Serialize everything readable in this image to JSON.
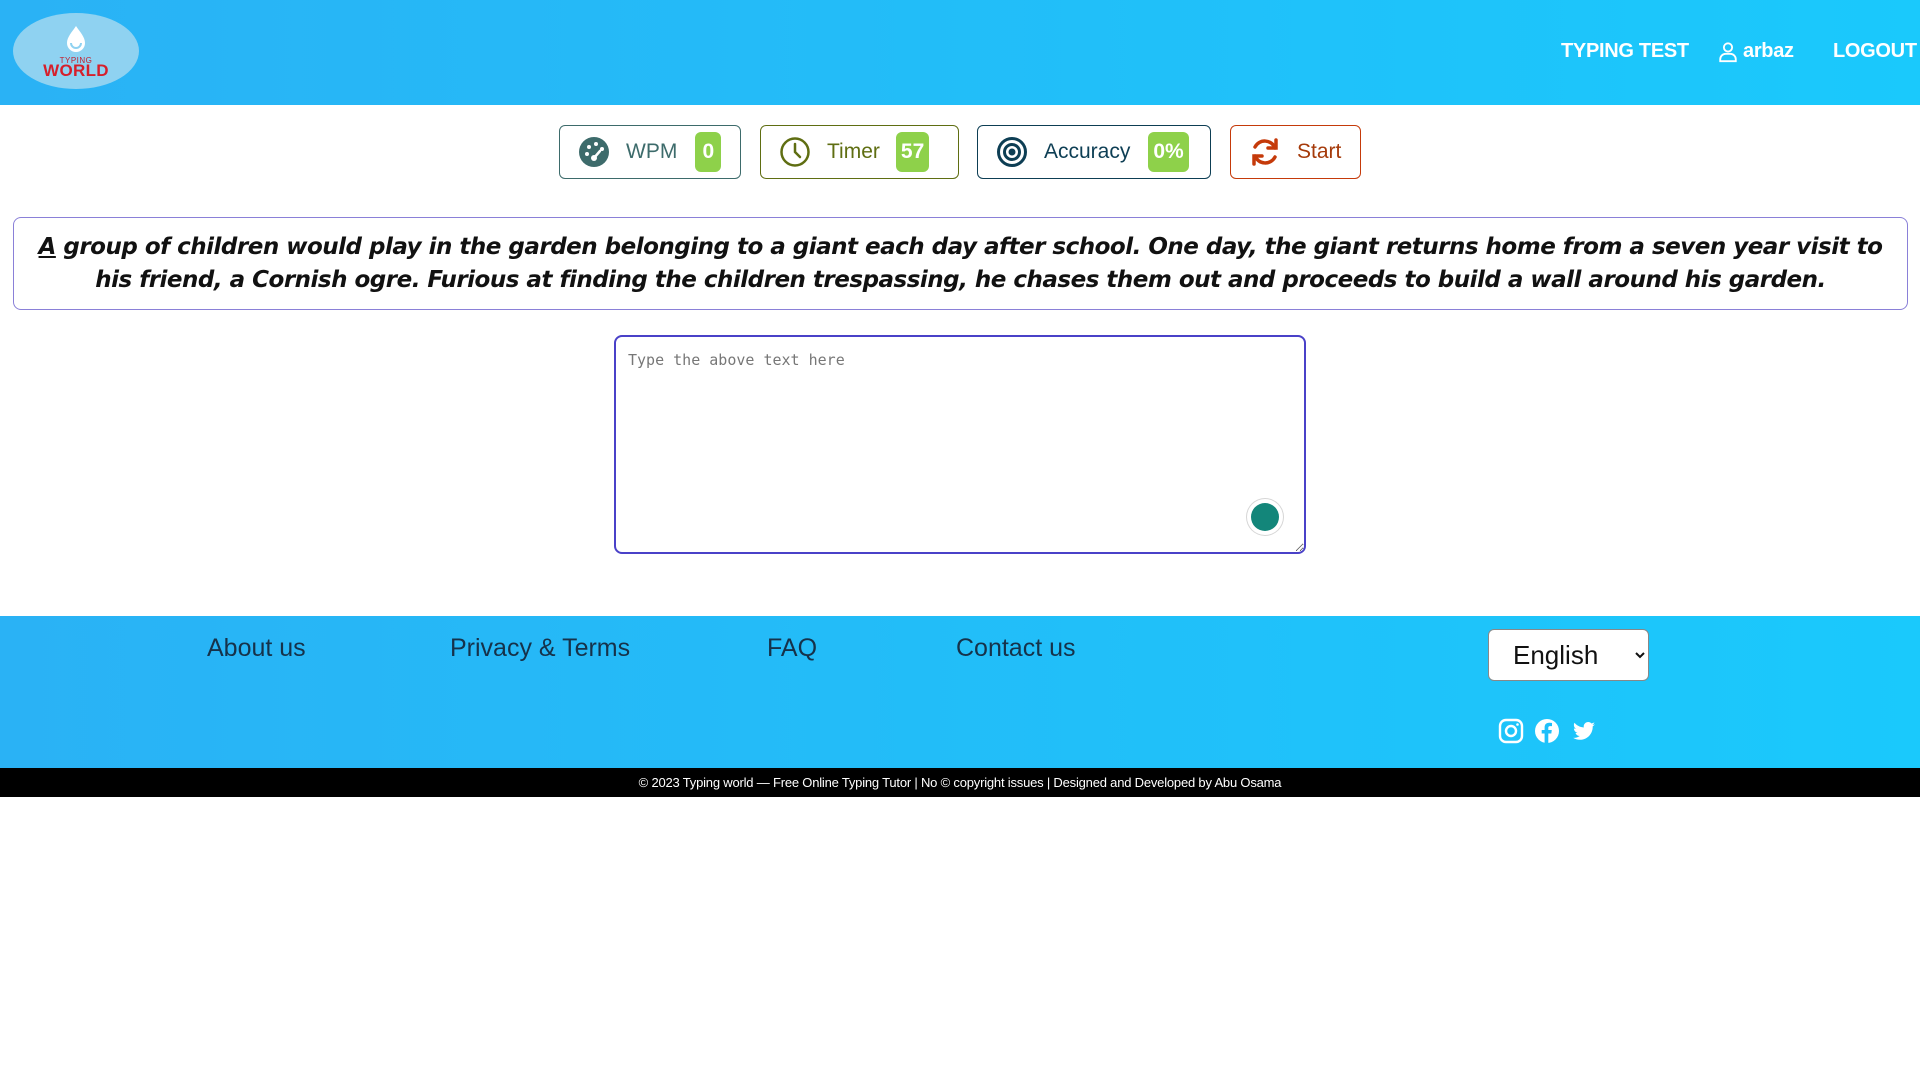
{
  "brand": {
    "logo_small_text": "TYPING",
    "logo_main_text": "WORLD",
    "logo_main_color": "#d61f2b"
  },
  "nav": {
    "typing_test_label": "TYPING TEST",
    "username": "arbaz",
    "logout_label": "LOGOUT"
  },
  "stats": {
    "wpm": {
      "label": "WPM",
      "value": "0",
      "icon": "gauge-icon"
    },
    "timer": {
      "label": "Timer",
      "value": "57",
      "icon": "clock-icon"
    },
    "accuracy": {
      "label": "Accuracy",
      "value": "0%",
      "icon": "target-icon"
    },
    "start": {
      "label": "Start",
      "icon": "refresh-icon"
    },
    "value_badge_color": "#8ed14a"
  },
  "passage": {
    "first_word": "A",
    "rest": " group of children would play in the garden belonging to a giant each day after school. One day, the giant returns home from a seven year visit to his friend, a Cornish ogre. Furious at finding the children trespassing, he chases them out and proceeds to build a wall around his garden."
  },
  "input": {
    "placeholder": "Type the above text here",
    "value": ""
  },
  "footer": {
    "links": [
      "About us",
      "Privacy & Terms",
      "FAQ",
      "Contact us"
    ],
    "language": {
      "selected": "English",
      "options": [
        "English"
      ]
    },
    "social_icons": [
      "instagram-icon",
      "facebook-icon",
      "twitter-icon"
    ],
    "copyright": "© 2023 Typing world — Free Online Typing Tutor | No © copyright issues | Designed and Developed by Abu Osama"
  },
  "colors": {
    "header_gradient_start": "#2ab2f5",
    "header_gradient_end": "#1ac9fc",
    "passage_border": "#8a80d8",
    "input_border": "#4a41c8"
  }
}
